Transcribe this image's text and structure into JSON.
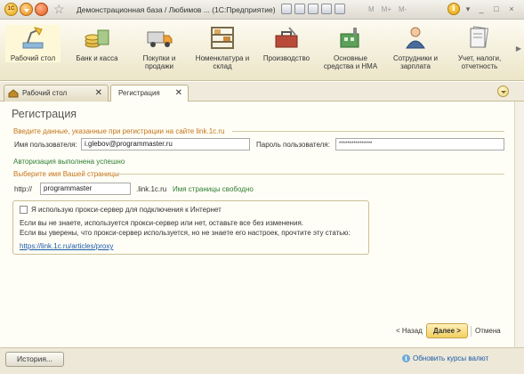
{
  "titlebar": {
    "logo_text": "1С",
    "title": "Демонстрационная база / Любимов ... (1С:Предприятие)",
    "memory": [
      "M",
      "M+",
      "M-"
    ],
    "info_symbol": "i",
    "controls": [
      "▾",
      "_",
      "□",
      "×"
    ]
  },
  "sections": [
    {
      "label": "Рабочий стол",
      "icon": "desk-lamp-icon"
    },
    {
      "label": "Банк и касса",
      "icon": "coins-icon"
    },
    {
      "label": "Покупки и продажи",
      "icon": "truck-icon"
    },
    {
      "label": "Номенклатура и склад",
      "icon": "warehouse-shelves-icon"
    },
    {
      "label": "Производство",
      "icon": "toolbox-icon"
    },
    {
      "label": "Основные средства и НМА",
      "icon": "factory-icon"
    },
    {
      "label": "Сотрудники и зарплата",
      "icon": "employee-icon"
    },
    {
      "label": "Учет, налоги, отчетность",
      "icon": "documents-icon"
    }
  ],
  "tabs": [
    {
      "label": "Рабочий стол",
      "close": "✕"
    },
    {
      "label": "Регистрация",
      "close": "✕"
    }
  ],
  "form": {
    "title": "Регистрация",
    "group1_title": "Введите данные, указанные при регистрации на сайте link.1c.ru",
    "username_label": "Имя пользователя:",
    "username_value": "i.glebov@programmaster.ru",
    "password_label": "Пароль пользователя:",
    "password_value": "****************",
    "auth_status": "Авторизация выполнена успешно",
    "group2_title": "Выберите имя Вашей страницы",
    "http_prefix": "http://",
    "page_name_value": "programmaster",
    "domain_suffix": ".link.1c.ru",
    "page_status": "Имя страницы свободно",
    "proxy_checkbox_label": "Я использую прокси-сервер для подключения к Интернет",
    "proxy_checkbox_checked": false,
    "proxy_text_1": "Если вы не знаете, используется прокси-сервер или нет, оставьте все без изменения.",
    "proxy_text_2": "Если вы уверены, что прокси-сервер используется, но не знаете его настроек, прочтите эту статью:",
    "proxy_link": "https://link.1c.ru/articles/proxy"
  },
  "buttons": {
    "back": "< Назад",
    "next": "Далее >",
    "cancel": "Отмена"
  },
  "statusbar": {
    "history": "История...",
    "update_rates": "Обновить курсы валют"
  },
  "colors": {
    "accent_orange": "#c2741b",
    "success_green": "#2e7d32",
    "link_blue": "#1c5aa8",
    "panel_yellow": "#ece5c8"
  }
}
